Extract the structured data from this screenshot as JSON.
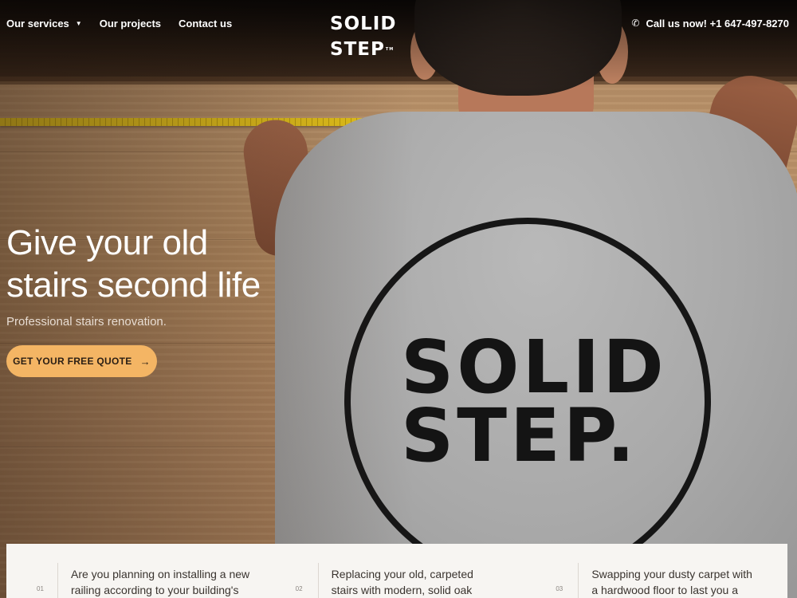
{
  "header": {
    "nav": [
      {
        "label": "Our services",
        "has_dropdown": true
      },
      {
        "label": "Our projects",
        "has_dropdown": false
      },
      {
        "label": "Contact us",
        "has_dropdown": false
      }
    ],
    "brand": "SOLID STEP",
    "brand_mark": "TM",
    "phone_label": "Call us now! +1 647-497-8270",
    "phone_icon": "phone-icon"
  },
  "hero": {
    "title_line1": "Give your old",
    "title_line2": "stairs second life",
    "subtitle": "Professional stairs renovation.",
    "cta_label": "GET YOUR FREE QUOTE",
    "cta_icon": "arrow-right-icon",
    "cta_color": "#f4b564",
    "shirt_logo_line1": "SOLID",
    "shirt_logo_line2": "STEP."
  },
  "services": [
    {
      "number": "01",
      "text_line1": "Are you planning on installing a new",
      "text_line2": "railing according to your building's"
    },
    {
      "number": "02",
      "text_line1": "Replacing your old, carpeted",
      "text_line2": "stairs with modern, solid oak"
    },
    {
      "number": "03",
      "text_line1": "Swapping your dusty carpet with",
      "text_line2": "a hardwood floor to last you a"
    }
  ]
}
